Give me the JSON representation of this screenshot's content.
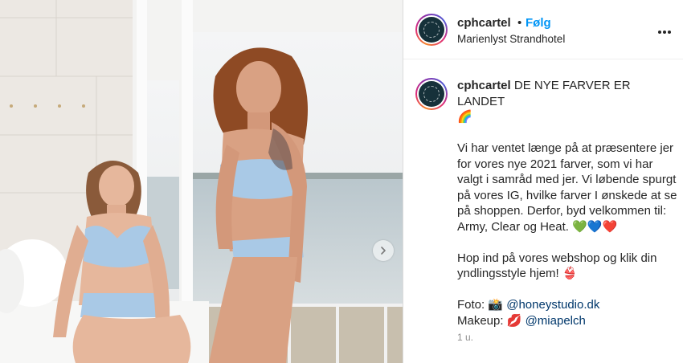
{
  "post": {
    "username": "cphcartel",
    "dot": "•",
    "follow_label": "Følg",
    "location": "Marienlyst Strandhotel",
    "more_icon": "more-horizontal-icon",
    "next_icon": "chevron-right-icon",
    "photo_alt": "Two women in light blue bikinis posing by a large window overlooking the sea"
  },
  "caption": {
    "username": "cphcartel",
    "headline": "DE NYE FARVER ER LANDET",
    "headline_emoji": "🌈",
    "paragraph1": "Vi har ventet længe på at præsentere jer for vores nye 2021 farver, som vi har valgt i samråd med jer. Vi løbende spurgt på vores IG, hvilke farver I ønskede at se på shoppen. Derfor, byd velkommen til: Army, Clear og Heat.",
    "paragraph1_emoji": "💚💙❤️",
    "paragraph2": "Hop ind på vores webshop og klik din yndlingsstyle hjem!",
    "paragraph2_emoji": "👙",
    "photo_label": "Foto:",
    "photo_emoji": "📸",
    "photo_link": "@honeystudio.dk",
    "makeup_label": "Makeup:",
    "makeup_emoji": "💋",
    "makeup_link": "@miapelch",
    "timestamp": "1 u."
  },
  "colors": {
    "follow": "#0095f6",
    "link": "#00376b",
    "muted": "#8e8e8e",
    "text": "#262626",
    "border": "#dbdbdb"
  }
}
